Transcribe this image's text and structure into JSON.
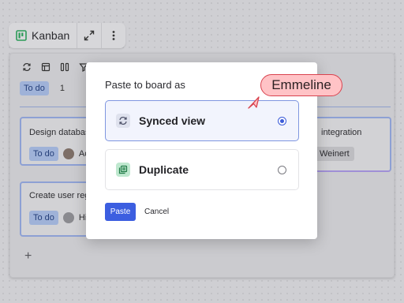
{
  "toolbar": {
    "title": "Kanban",
    "logo_icon": "board-logo-icon",
    "expand_icon": "expand-icon",
    "more_icon": "more-vertical-icon"
  },
  "board": {
    "tool_icons": [
      "sync-icon",
      "table-view-icon",
      "columns-icon",
      "filter-icon",
      "sort-icon",
      "more-icon"
    ],
    "column": {
      "status": "To do",
      "count": "1"
    },
    "cards": [
      {
        "title": "Design databas",
        "status": "To do",
        "assignee": "Ac"
      },
      {
        "title": "Create user reg",
        "status": "To do",
        "assignee": "Hi"
      }
    ],
    "right_card": {
      "title": "integration",
      "assignee": "Weinert"
    },
    "add_label": "+"
  },
  "dialog": {
    "title": "Paste to board as",
    "options": [
      {
        "label": "Synced view",
        "icon": "synced-view-icon",
        "selected": true
      },
      {
        "label": "Duplicate",
        "icon": "duplicate-icon",
        "selected": false
      }
    ],
    "paste_label": "Paste",
    "cancel_label": "Cancel"
  },
  "cursor": {
    "name": "Emmeline",
    "color": "#d9434f"
  },
  "colors": {
    "accent": "#3c5ee0",
    "tag": "#9fb2d8",
    "duplicate_icon_bg": "#bfe8cf"
  }
}
